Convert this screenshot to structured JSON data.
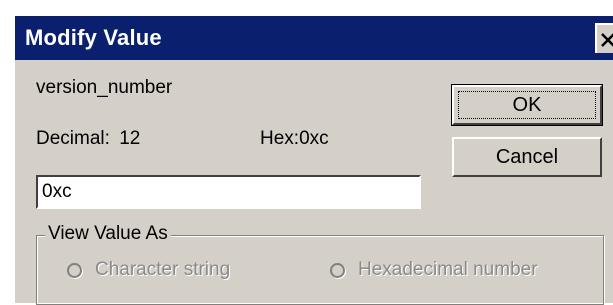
{
  "window": {
    "title": "Modify Value",
    "close_label": "✕"
  },
  "value_name": "version_number",
  "decimal": {
    "label": "Decimal:",
    "value": "12"
  },
  "hex": {
    "label": "Hex:",
    "value": "0xc"
  },
  "input": {
    "value": "0xc"
  },
  "buttons": {
    "ok": "OK",
    "cancel": "Cancel"
  },
  "view_value_as": {
    "legend": "View Value As",
    "options": [
      "Character string",
      "Hexadecimal number"
    ]
  },
  "colors": {
    "titlebar": "#0a1f6e",
    "dialog_bg": "#d4d0c8",
    "disabled_text": "#8a8a8a"
  }
}
